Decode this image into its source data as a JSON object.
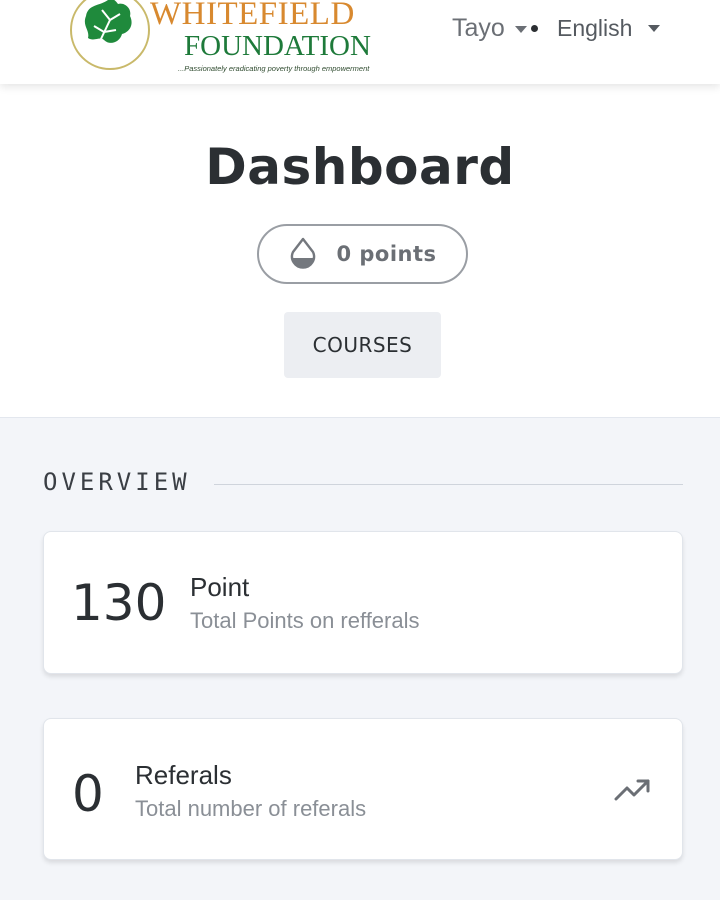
{
  "header": {
    "logo": {
      "word1": "WHITEFIELD",
      "word2": "FOUNDATION",
      "tagline": "...Passionately eradicating poverty through empowerment",
      "icon": "leaf-icon"
    },
    "user_name": "Tayo",
    "language": "English"
  },
  "main": {
    "page_title": "Dashboard",
    "points_badge": "0 points",
    "points_icon": "droplet-icon",
    "courses_button": "COURSES"
  },
  "overview": {
    "heading": "OVERVIEW",
    "cards": [
      {
        "value": "130",
        "title": "Point",
        "subtitle": "Total Points on refferals"
      },
      {
        "value": "0",
        "title": "Referals",
        "subtitle": "Total number of referals",
        "icon": "trending-up-icon"
      }
    ]
  },
  "colors": {
    "logo_orange": "#d8892f",
    "logo_green": "#1e7a3a",
    "page_background": "#f3f5f9",
    "text_dark": "#2b2f33",
    "text_muted": "#8a8f96"
  }
}
